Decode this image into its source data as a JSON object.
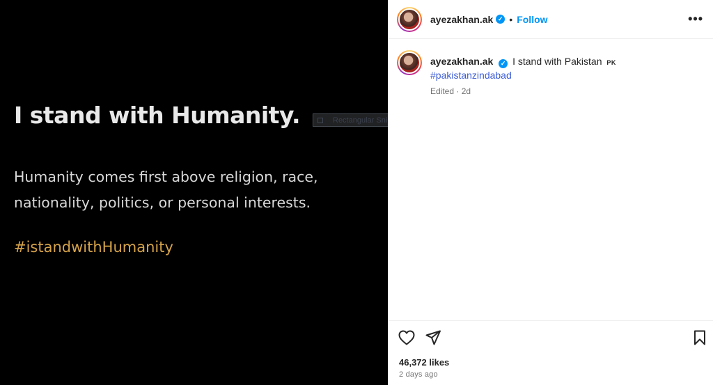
{
  "image": {
    "heading": "I stand with Humanity.",
    "body": "Humanity comes first above religion, race, nationality, politics, or personal interests.",
    "hashtag": "#istandwithHumanity",
    "snip_label": "Rectangular Snip"
  },
  "header": {
    "username": "ayezakhan.ak",
    "separator": "•",
    "follow_label": "Follow",
    "more_label": "•••"
  },
  "caption": {
    "username": "ayezakhan.ak",
    "text": "I stand with Pakistan",
    "flag": "PK",
    "hashtag": "#pakistanzindabad",
    "meta": "Edited · 2d"
  },
  "actions": {
    "icons": [
      "heart-icon",
      "share-icon",
      "bookmark-icon"
    ]
  },
  "likes": "46,372 likes",
  "time_ago": "2 days ago",
  "colors": {
    "accent": "#0095f6",
    "hashtag_image": "#d4a24a",
    "hashtag_caption": "#3b5bd6"
  }
}
